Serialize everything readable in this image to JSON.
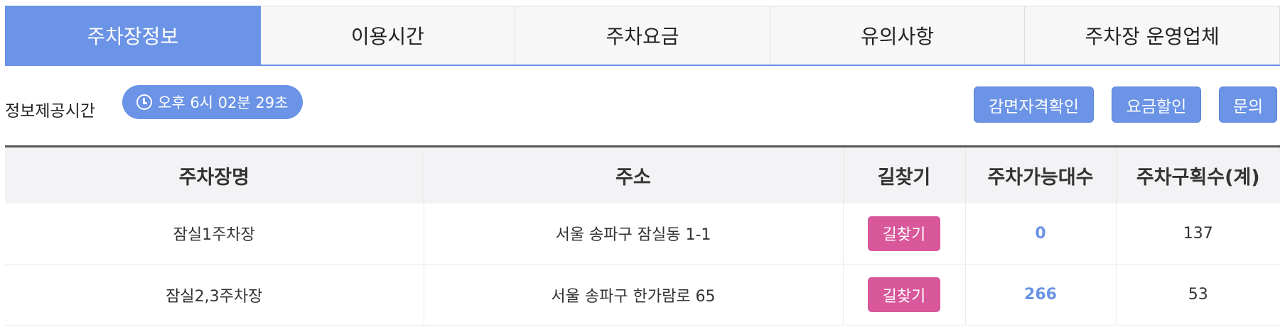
{
  "tabs": [
    {
      "label": "주차장정보",
      "active": true
    },
    {
      "label": "이용시간",
      "active": false
    },
    {
      "label": "주차요금",
      "active": false
    },
    {
      "label": "유의사항",
      "active": false
    },
    {
      "label": "주차장 운영업체",
      "active": false
    }
  ],
  "info": {
    "label": "정보제공시간",
    "time": "오후 6시 02분 29초"
  },
  "actions": {
    "exempt": "감면자격확인",
    "discount": "요금할인",
    "inquiry": "문의"
  },
  "table": {
    "headers": [
      "주차장명",
      "주소",
      "길찾기",
      "주차가능대수",
      "주차구획수(계)"
    ],
    "rows": [
      {
        "name": "잠실1주차장",
        "address": "서울 송파구 잠실동 1-1",
        "directions": "길찾기",
        "available": "0",
        "total": "137"
      },
      {
        "name": "잠실2,3주차장",
        "address": "서울 송파구 한가람로 65",
        "directions": "길찾기",
        "available": "266",
        "total": "53"
      }
    ]
  },
  "colors": {
    "accent": "#6b93e6",
    "directions_button": "#d9579b"
  },
  "icons": {
    "time_badge": "clock-icon"
  }
}
